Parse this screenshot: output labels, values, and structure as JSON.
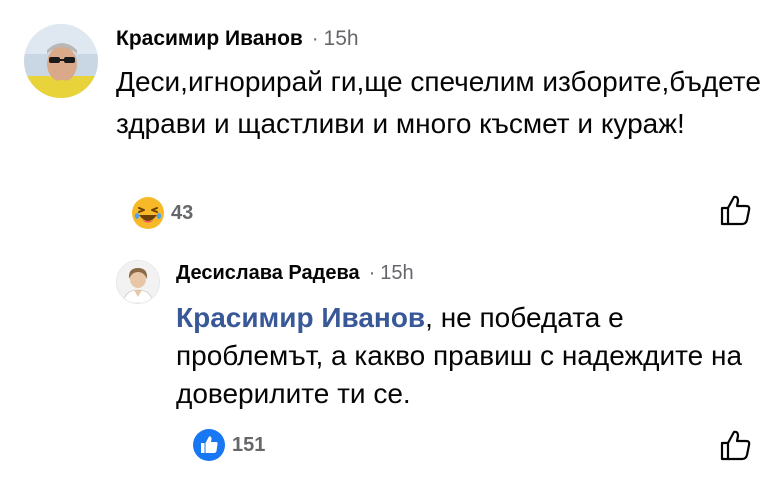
{
  "comments": [
    {
      "author": "Красимир Иванов",
      "separator": "·",
      "time": "15h",
      "text": "Деси,игнорирай ги,ще спечелим изборите,бъдете здрави и щастливи и много късмет и кураж!",
      "reaction_icon": "haha-emoji-icon",
      "reaction_count": "43",
      "like_icon": "thumbs-up-outline-icon"
    }
  ],
  "reply": {
    "author": "Десислава Радева",
    "separator": "·",
    "time": "15h",
    "mention": "Красимир Иванов",
    "text": ", не победата е проблемът, а какво правиш с надеждите на доверилите ти се.",
    "reaction_icon": "like-reaction-icon",
    "reaction_count": "151",
    "like_icon": "thumbs-up-outline-icon"
  },
  "colors": {
    "mention": "#385898",
    "secondary_text": "#65676b",
    "like_blue": "#1877f2",
    "haha_yellow": "#f7b928"
  }
}
